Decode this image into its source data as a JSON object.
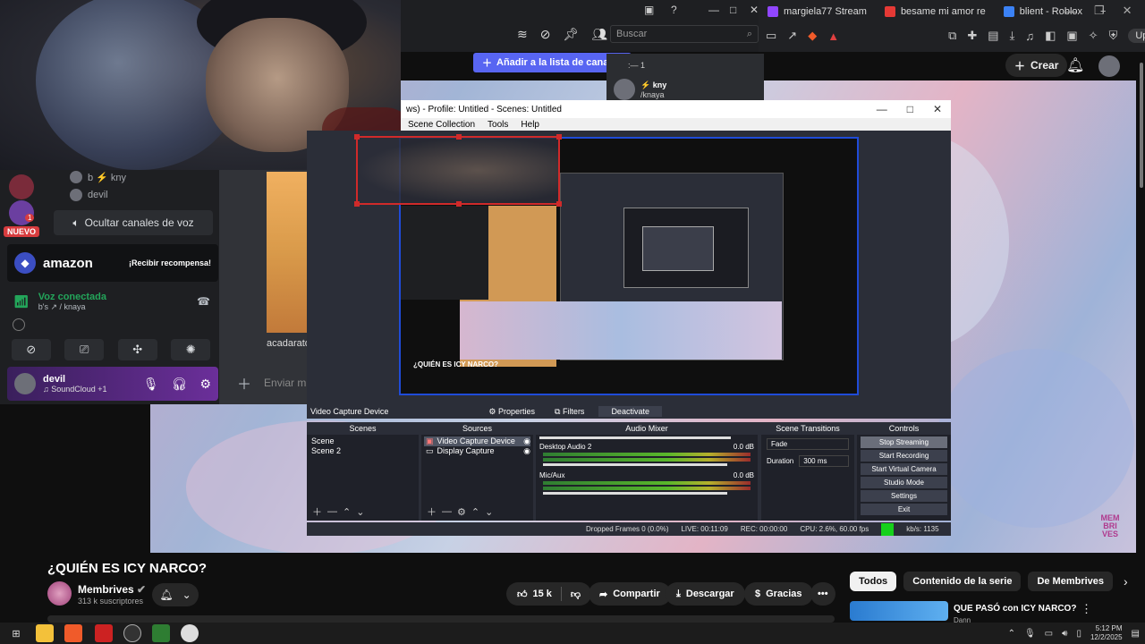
{
  "browser": {
    "tabs": [
      {
        "label": "margiela77 Stream",
        "color": "#9146ff"
      },
      {
        "label": "besame mi amor re",
        "color": "#e53935"
      },
      {
        "label": "blient - Roblox",
        "color": "#3b82f6"
      }
    ],
    "new_tab": "+",
    "update_label": "Update"
  },
  "discord": {
    "search_placeholder": "Buscar",
    "add_channels": "Añadir a la lista de canales",
    "members": [
      {
        "name": ":— 1"
      },
      {
        "name": "⚡ kny",
        "sub": "/knaya"
      }
    ],
    "sidebar_badge": "1",
    "nuevo_label": "NUEVO",
    "voice_users": [
      "b ⚡ kny",
      "devil"
    ],
    "hide_voice": "Ocultar canales de voz",
    "amazon": {
      "name": "amazon",
      "cta": "¡Recibir recompensa!"
    },
    "voice": {
      "status": "Voz conectada",
      "channel": "b's ↗ / knaya"
    },
    "user": {
      "name": "devil",
      "status": "♫ SoundCloud +1"
    },
    "chat_placeholder": "Enviar m",
    "thumb_label": "acadarato"
  },
  "obs": {
    "window_title": "ws) - Profile: Untitled - Scenes: Untitled",
    "menu": [
      "Scene Collection",
      "Tools",
      "Help"
    ],
    "preview_video_title": "¿QUIÉN ES ICY NARCO?",
    "context": {
      "source": "Video Capture Device",
      "properties": "Properties",
      "filters": "Filters",
      "deactivate": "Deactivate"
    },
    "docks": {
      "scenes": {
        "title": "Scenes",
        "items": [
          "Scene",
          "Scene 2"
        ]
      },
      "sources": {
        "title": "Sources",
        "items": [
          "Video Capture Device",
          "Display Capture"
        ]
      },
      "mixer": {
        "title": "Audio Mixer",
        "channels": [
          {
            "name": "Desktop Audio 2",
            "db": "0.0 dB"
          },
          {
            "name": "Mic/Aux",
            "db": "0.0 dB"
          }
        ],
        "scale": [
          "-60",
          "-55",
          "-50",
          "-45",
          "-40",
          "-35",
          "-30",
          "-25",
          "-20",
          "-15",
          "-10",
          "-5",
          "0"
        ]
      },
      "transitions": {
        "title": "Scene Transitions",
        "type": "Fade",
        "duration_label": "Duration",
        "duration": "300 ms"
      },
      "controls": {
        "title": "Controls",
        "buttons": [
          "Stop Streaming",
          "Start Recording",
          "Start Virtual Camera",
          "Studio Mode",
          "Settings",
          "Exit"
        ]
      }
    },
    "status": {
      "dropped": "Dropped Frames 0 (0.0%)",
      "live": "LIVE: 00:11:09",
      "rec": "REC: 00:00:00",
      "cpu": "CPU: 2.6%, 60.00 fps",
      "bitrate": "kb/s: 1135"
    }
  },
  "youtube": {
    "create": "Crear",
    "watermark": "MEM BRI VES",
    "title": "¿QUIÉN ES ICY NARCO?",
    "channel": "Membrives",
    "subscribers": "313 k suscriptores",
    "likes": "15 k",
    "share": "Compartir",
    "download": "Descargar",
    "thanks": "Gracias",
    "more": "•••",
    "chips": [
      "Todos",
      "Contenido de la serie",
      "De Membrives"
    ],
    "rec_title": "QUE PASÓ con ICY NARCO?",
    "rec_channel": "Dann"
  },
  "taskbar": {
    "time": "5:12 PM",
    "date": "12/2/2025"
  }
}
